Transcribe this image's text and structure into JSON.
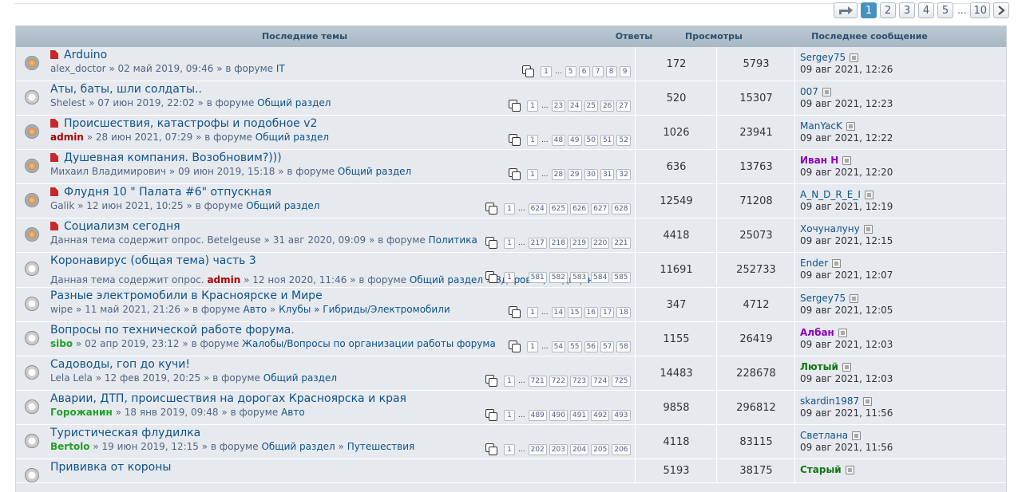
{
  "pagination": {
    "pages": [
      "1",
      "2",
      "3",
      "4",
      "5"
    ],
    "ellipsis": "...",
    "last": "10",
    "active": "1"
  },
  "header": {
    "topics": "Последние темы",
    "replies": "Ответы",
    "views": "Просмотры",
    "last_post": "Последнее сообщение"
  },
  "topics": [
    {
      "title": "Arduino",
      "sticky": true,
      "hot": true,
      "author": "alex_doctor",
      "author_style": "",
      "date": "02 май 2019, 09:46",
      "pre": "",
      "forum": "IT",
      "sub": "",
      "pages": [
        "1",
        "5",
        "6",
        "7",
        "8",
        "9"
      ],
      "replies": "172",
      "views": "5793",
      "last_user": "Sergey75",
      "last_style": "",
      "last_time": "09 авг 2021, 12:26"
    },
    {
      "title": "Аты, баты, шли солдаты..",
      "sticky": false,
      "hot": false,
      "author": "Shelest",
      "author_style": "",
      "date": "07 июн 2019, 22:02",
      "pre": "",
      "forum": "Общий раздел",
      "sub": "",
      "pages": [
        "1",
        "23",
        "24",
        "25",
        "26",
        "27"
      ],
      "replies": "520",
      "views": "15307",
      "last_user": "007",
      "last_style": "",
      "last_time": "09 авг 2021, 12:23"
    },
    {
      "title": "Происшествия, катастрофы и подобное v2",
      "sticky": true,
      "hot": true,
      "author": "admin",
      "author_style": "adm",
      "date": "28 июн 2021, 07:29",
      "pre": "",
      "forum": "Общий раздел",
      "sub": "",
      "pages": [
        "1",
        "48",
        "49",
        "50",
        "51",
        "52"
      ],
      "replies": "1026",
      "views": "23941",
      "last_user": "ManYacK",
      "last_style": "",
      "last_time": "09 авг 2021, 12:22"
    },
    {
      "title": "Душевная компания. Возобновим?)))",
      "sticky": true,
      "hot": true,
      "author": "Михаил Владимирович",
      "author_style": "",
      "date": "09 июн 2019, 15:18",
      "pre": "",
      "forum": "Общий раздел",
      "sub": "",
      "pages": [
        "1",
        "28",
        "29",
        "30",
        "31",
        "32"
      ],
      "replies": "636",
      "views": "13763",
      "last_user": "Иван Н",
      "last_style": "purple",
      "last_time": "09 авг 2021, 12:20"
    },
    {
      "title": "Флудня 10 \" Палата #6\" отпускная",
      "sticky": true,
      "hot": true,
      "author": "Galik",
      "author_style": "",
      "date": "12 июн 2021, 10:25",
      "pre": "",
      "forum": "Общий раздел",
      "sub": "",
      "pages": [
        "1",
        "624",
        "625",
        "626",
        "627",
        "628"
      ],
      "replies": "12549",
      "views": "71208",
      "last_user": "A_N_D_R_E_I",
      "last_style": "",
      "last_time": "09 авг 2021, 12:19"
    },
    {
      "title": "Социализм сегодня",
      "sticky": true,
      "hot": true,
      "author": "Betelgeuse",
      "author_style": "",
      "date": "31 авг 2020, 09:09",
      "pre": "Данная тема содержит опрос.",
      "forum": "Политика",
      "sub": "",
      "pages": [
        "1",
        "217",
        "218",
        "219",
        "220",
        "221"
      ],
      "replies": "4418",
      "views": "25073",
      "last_user": "Хочуналуну",
      "last_style": "",
      "last_time": "09 авг 2021, 12:15"
    },
    {
      "title": "Коронавирус (общая тема) часть 3",
      "sticky": false,
      "hot": false,
      "author": "admin",
      "author_style": "adm",
      "date": "12 ноя 2020, 11:46",
      "pre": "Данная тема содержит опрос.",
      "forum": "Общий раздел",
      "sub": "Здоровье, медицина",
      "pages": [
        "1",
        "581",
        "582",
        "583",
        "584",
        "585"
      ],
      "replies": "11691",
      "views": "252733",
      "last_user": "Ender",
      "last_style": "",
      "last_time": "09 авг 2021, 12:07"
    },
    {
      "title": "Разные электромобили в Красноярске и Мире",
      "sticky": false,
      "hot": false,
      "author": "wipe",
      "author_style": "",
      "date": "11 май 2021, 21:26",
      "pre": "",
      "forum": "Авто",
      "sub": "Клубы » Гибриды/Электромобили",
      "pages": [
        "1",
        "14",
        "15",
        "16",
        "17",
        "18"
      ],
      "replies": "347",
      "views": "4712",
      "last_user": "Sergey75",
      "last_style": "",
      "last_time": "09 авг 2021, 12:05"
    },
    {
      "title": "Вопросы по технической работе форума.",
      "sticky": false,
      "hot": false,
      "author": "sibo",
      "author_style": "grn",
      "date": "02 апр 2019, 23:12",
      "pre": "",
      "forum": "Жалобы/Вопросы по организации работы форума",
      "sub": "",
      "pages": [
        "1",
        "54",
        "55",
        "56",
        "57",
        "58"
      ],
      "replies": "1155",
      "views": "26419",
      "last_user": "Албан",
      "last_style": "purple",
      "last_time": "09 авг 2021, 12:03"
    },
    {
      "title": "Садоводы, гоп до кучи!",
      "sticky": false,
      "hot": false,
      "author": "Lela Lela",
      "author_style": "",
      "date": "12 фев 2019, 20:25",
      "pre": "",
      "forum": "Общий раздел",
      "sub": "",
      "pages": [
        "1",
        "721",
        "722",
        "723",
        "724",
        "725"
      ],
      "replies": "14483",
      "views": "228678",
      "last_user": "Лютый",
      "last_style": "green",
      "last_time": "09 авг 2021, 12:03"
    },
    {
      "title": "Аварии, ДТП, происшествия на дорогах Красноярска и края",
      "sticky": false,
      "hot": false,
      "author": "Горожанин",
      "author_style": "grn",
      "date": "18 янв 2019, 09:48",
      "pre": "",
      "forum": "Авто",
      "sub": "",
      "pages": [
        "1",
        "489",
        "490",
        "491",
        "492",
        "493"
      ],
      "replies": "9858",
      "views": "296812",
      "last_user": "skardin1987",
      "last_style": "",
      "last_time": "09 авг 2021, 11:56"
    },
    {
      "title": "Туристическая флудилка",
      "sticky": false,
      "hot": false,
      "author": "Bertolo",
      "author_style": "grn",
      "date": "19 июн 2019, 12:15",
      "pre": "",
      "forum": "Общий раздел",
      "sub": "Путешествия",
      "pages": [
        "1",
        "202",
        "203",
        "204",
        "205",
        "206"
      ],
      "replies": "4118",
      "views": "83115",
      "last_user": "Светлана",
      "last_style": "",
      "last_time": "09 авг 2021, 11:56"
    },
    {
      "title": "Прививка от короны",
      "sticky": false,
      "hot": false,
      "author": "",
      "author_style": "",
      "date": "",
      "pre": "",
      "forum": "",
      "sub": "",
      "pages": [],
      "replies": "5193",
      "views": "38175",
      "last_user": "Старый",
      "last_style": "green",
      "last_time": ""
    }
  ],
  "labels": {
    "in_forum": "в форуме",
    "sep": "»",
    "dots": "..."
  }
}
